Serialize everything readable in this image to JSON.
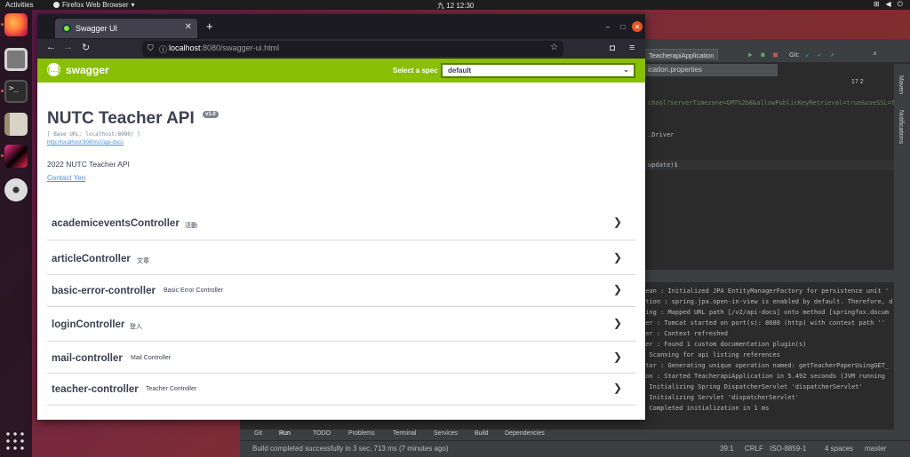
{
  "desktop": {
    "topbar": {
      "activities": "Activities",
      "app_name": "Firefox Web Browser",
      "clock": "九 12  12:30",
      "sys_icons": [
        "network-icon",
        "volume-icon",
        "power-icon"
      ]
    },
    "dock_apps": [
      "firefox",
      "files",
      "terminal",
      "text-editor",
      "intellij-idea",
      "disc"
    ]
  },
  "browser": {
    "tab_title": "Swagger UI",
    "new_tab_symbol": "+",
    "url_host": "localhost",
    "url_rest": ":8080/swagger-ui.html"
  },
  "swagger": {
    "logo_text": "swagger",
    "spec_label": "Select a spec",
    "spec_selected": "default",
    "api_title": "NUTC Teacher API",
    "version": "v1.0",
    "base_url": "[ Base URL: localhost:8080/ ]",
    "docs_link": "http://localhost:8080/v2/api-docs",
    "description": "2022 NUTC Teacher API",
    "contact": "Contact Yen",
    "tags": [
      {
        "name": "academiceventsController",
        "desc": "活動"
      },
      {
        "name": "articleController",
        "desc": "文章"
      },
      {
        "name": "basic-error-controller",
        "desc": "Basic Error Controller"
      },
      {
        "name": "loginController",
        "desc": "登入"
      },
      {
        "name": "mail-controller",
        "desc": "Mail Controller"
      },
      {
        "name": "teacher-controller",
        "desc": "Teacher Controller"
      }
    ]
  },
  "ide": {
    "run_config": "TeacherapiApplication",
    "git_label": "Git:",
    "tab_title": "ication.properties",
    "warnings": "17  2",
    "code_lines": [
      "chool?serverTimezone=GMT%2b8&allowPublicKeyRetrieval=true&useSSL=f",
      ".Driver",
      " update)$"
    ],
    "side_labels": [
      "Maven",
      "Notifications"
    ],
    "log_lines": [
      "Bean : Initialized JPA EntityManagerFactory for persistence unit '",
      "ation : spring.jpa.open-in-view is enabled by default. Therefore, d",
      "ping : Mapped URL path [/v2/api-docs] onto method [springfox.docum",
      "ver  : Tomcat started on port(s): 8080 (http) with context path ''",
      "per  : Context refreshed",
      "per  : Found 1 custom documentation plugin(s)",
      "     : Scanning for api listing references",
      "ator : Generating unique operation named: getTeacherPaperUsingGET_",
      "ion  : Started TeacherapiApplication in 5.492 seconds (JVM running",
      "     : Initializing Spring DispatcherServlet 'dispatcherServlet'",
      "     : Initializing Servlet 'dispatcherServlet'",
      "     : Completed initialization in 1 ms"
    ],
    "bottom_tabs": [
      "Git",
      "Run",
      "TODO",
      "Problems",
      "Terminal",
      "Services",
      "Build",
      "Dependencies"
    ],
    "status_message": "Build completed successfully in 3 sec, 713 ms (7 minutes ago)",
    "status_position": "39:1",
    "status_eol": "CRLF",
    "status_encoding": "ISO-8859-1",
    "status_indent": "4 spaces",
    "status_branch": "master"
  }
}
